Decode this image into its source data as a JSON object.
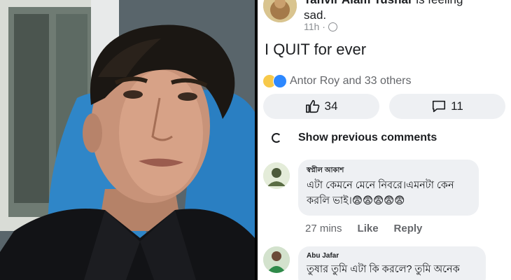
{
  "post": {
    "poster_name": "Tanvir Alam Tushar",
    "feeling": "is feeling",
    "feeling_value": "sad.",
    "time": "11h ·",
    "text": "I QUIT for ever",
    "reactions_text": "Antor Roy and 33 others",
    "like_count": "34",
    "comment_count": "11"
  },
  "comments_section": {
    "show_previous": "Show previous comments",
    "comments": [
      {
        "name": "স্বপ্নীল আকাশ",
        "text": "এটা কেমনে মেনে নিবরে।এমনটা কেন করলি ভাই।😨😨😨😨😨",
        "time": "27 mins",
        "like": "Like",
        "reply": "Reply"
      },
      {
        "name": "Abu Jafar",
        "text": "তুষার তুমি এটা কি করলে?  তুমি অনেক"
      }
    ]
  },
  "colors": {
    "background": "#ffffff",
    "bubble": "#eef0f3",
    "muted_text": "#65676b",
    "like_blue": "#2d88ff",
    "sad_yellow": "#f7c94a"
  }
}
